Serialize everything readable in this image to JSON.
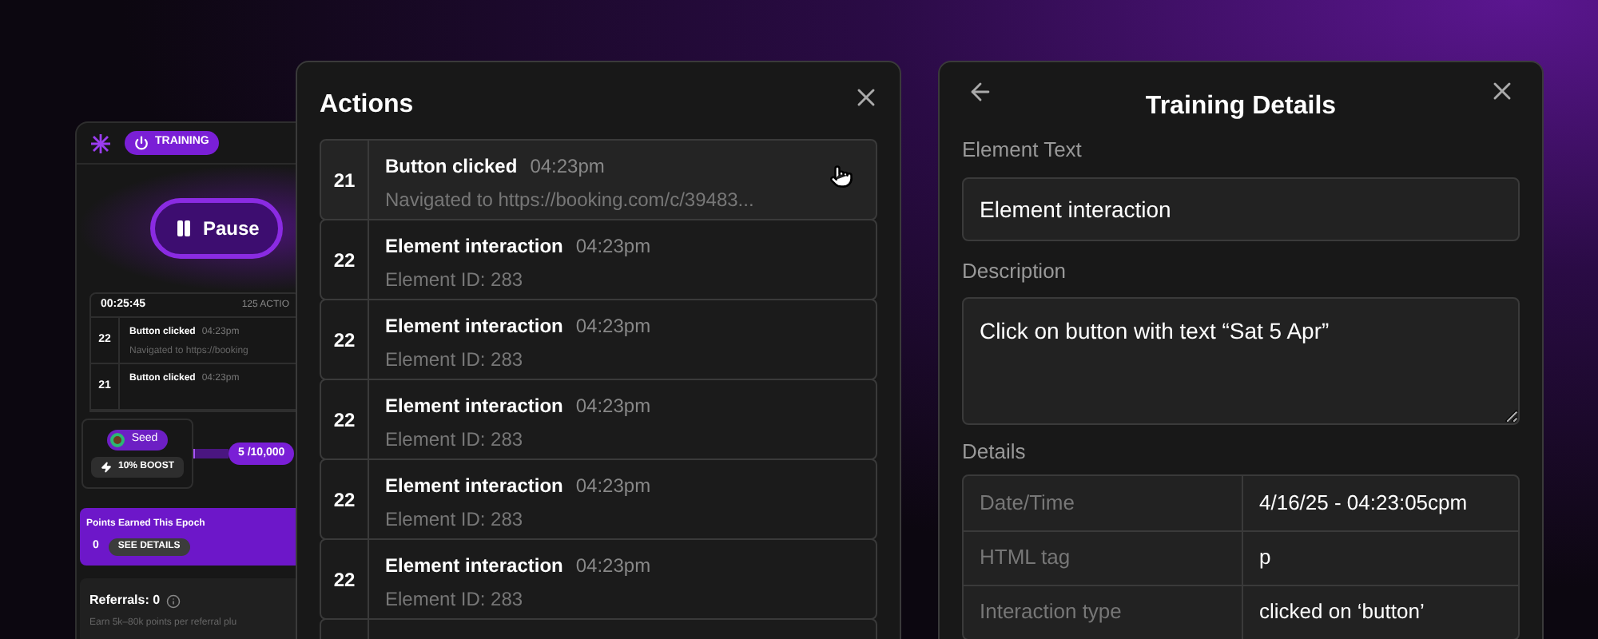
{
  "training_panel": {
    "status_badge": "TRAINING",
    "pause_button": "Pause",
    "timer": "00:25:45",
    "actions_count": "125 ACTIO",
    "recent_actions": [
      {
        "number": "22",
        "title": "Button clicked",
        "time": "04:23pm",
        "detail": "Navigated to https://booking"
      },
      {
        "number": "21",
        "title": "Button clicked",
        "time": "04:23pm"
      }
    ],
    "rank": "Seed",
    "boost": "10% BOOST",
    "progress": {
      "reading": "5 /10,000",
      "level": 0.0005
    },
    "points_card": {
      "title": "Points Earned This Epoch",
      "value": "0",
      "button": "SEE DETAILS"
    },
    "referrals": {
      "title": "Referrals: 0",
      "note": "Earn 5k–80k points per referral plu"
    }
  },
  "actions_window": {
    "title": "Actions",
    "rows": [
      {
        "number": "21",
        "title": "Button clicked",
        "time": "04:23pm",
        "detail": "Navigated to https://booking.com/c/39483...",
        "hovered": true
      },
      {
        "number": "22",
        "title": "Element interaction",
        "time": "04:23pm",
        "detail": "Element ID: 283",
        "hovered": false
      },
      {
        "number": "22",
        "title": "Element interaction",
        "time": "04:23pm",
        "detail": "Element ID: 283",
        "hovered": false
      },
      {
        "number": "22",
        "title": "Element interaction",
        "time": "04:23pm",
        "detail": "Element ID: 283",
        "hovered": false
      },
      {
        "number": "22",
        "title": "Element interaction",
        "time": "04:23pm",
        "detail": "Element ID: 283",
        "hovered": false
      },
      {
        "number": "22",
        "title": "Element interaction",
        "time": "04:23pm",
        "detail": "Element ID: 283",
        "hovered": false
      }
    ]
  },
  "details_window": {
    "title": "Training Details",
    "element_text": {
      "label": "Element Text",
      "value": "Element interaction"
    },
    "description": {
      "label": "Description",
      "value": "Click on button with text “Sat 5 Apr”"
    },
    "details": {
      "label": "Details",
      "rows": [
        {
          "key": "Date/Time",
          "value": "4/16/25 - 04:23:05cpm"
        },
        {
          "key": "HTML tag",
          "value": "p"
        },
        {
          "key": "Interaction type",
          "value": "clicked on ‘button’"
        }
      ]
    }
  }
}
